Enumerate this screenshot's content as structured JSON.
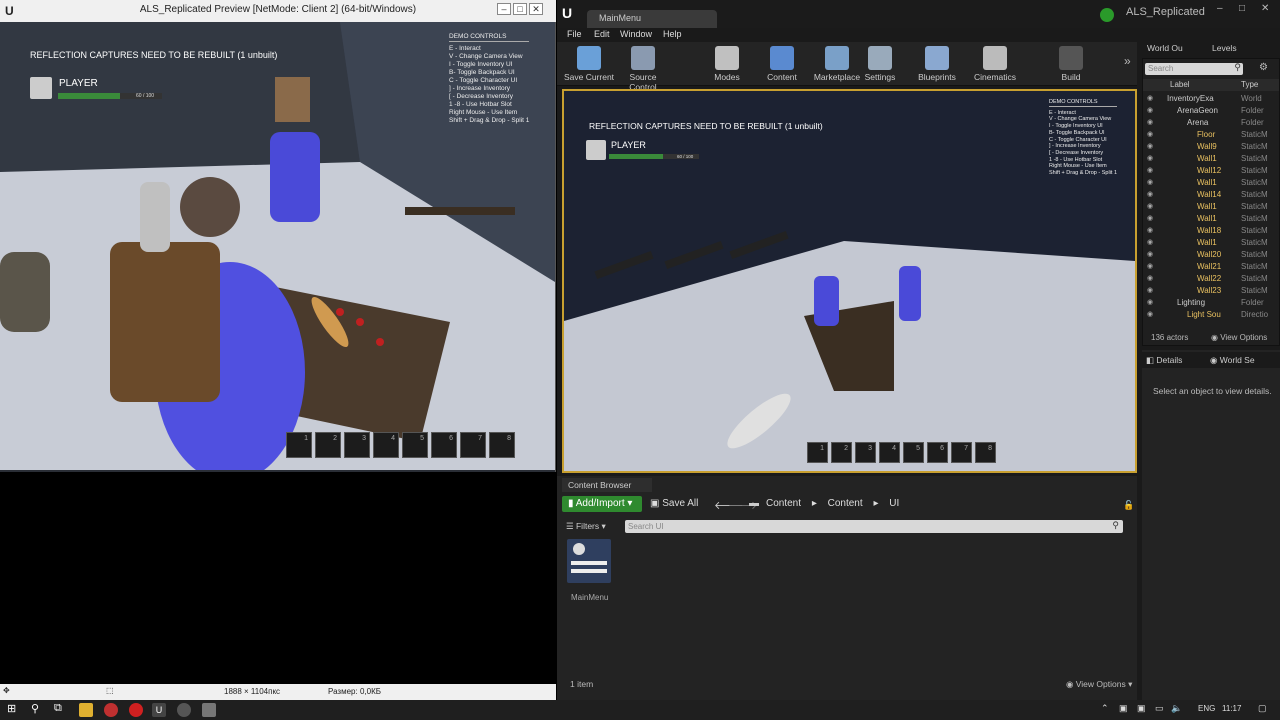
{
  "preview": {
    "title": "ALS_Replicated Preview [NetMode: Client 2]  (64-bit/Windows)",
    "warning": "REFLECTION CAPTURES NEED TO BE REBUILT (1 unbuilt)",
    "player_name": "PLAYER",
    "health_text": "60 / 100",
    "health_fraction": 0.6,
    "demo_title": "DEMO CONTROLS",
    "demo_lines": [
      "E - Interact",
      "V - Change Camera View",
      "I - Toggle Inventory UI",
      "B- Toggle Backpack UI",
      "C - Toggle Character UI",
      "] - Increase Inventory",
      "[ - Decrease Inventory",
      "1 -8 - Use Hotbar Slot",
      "Right Mouse - Use Item",
      "Shift + Drag & Drop - Split 1"
    ],
    "hotbar": [
      "1",
      "2",
      "3",
      "4",
      "5",
      "6",
      "7",
      "8"
    ]
  },
  "statusbar": {
    "dimensions": "1888 × 1104пкс",
    "size": "Размер: 0,0КБ"
  },
  "editor": {
    "tab": "MainMenu",
    "project": "ALS_Replicated",
    "menu": [
      "File",
      "Edit",
      "Window",
      "Help"
    ],
    "toolbar": [
      {
        "label": "Save Current",
        "icon": "save-icon",
        "color": "#6aa0d8"
      },
      {
        "label": "Source Control",
        "icon": "source-control-icon",
        "color": "#8a9ab0"
      },
      {
        "label": "Modes",
        "icon": "modes-icon",
        "color": "#c0c0c0"
      },
      {
        "label": "Content",
        "icon": "content-icon",
        "color": "#5a8ad0"
      },
      {
        "label": "Marketplace",
        "icon": "marketplace-icon",
        "color": "#7aa0c8"
      },
      {
        "label": "Settings",
        "icon": "settings-icon",
        "color": "#9ab"
      },
      {
        "label": "Blueprints",
        "icon": "blueprints-icon",
        "color": "#8aa8d0"
      },
      {
        "label": "Cinematics",
        "icon": "cinematics-icon",
        "color": "#bbb"
      },
      {
        "label": "Build",
        "icon": "build-icon",
        "color": "#555"
      }
    ],
    "viewport": {
      "warning": "REFLECTION CAPTURES NEED TO BE REBUILT (1 unbuilt)",
      "player_name": "PLAYER",
      "health_text": "60 / 100",
      "hotbar": [
        "1",
        "2",
        "3",
        "4",
        "5",
        "6",
        "7",
        "8"
      ]
    },
    "outliner": {
      "tabs": [
        "World Ou",
        "Levels"
      ],
      "search_placeholder": "Search",
      "col_label": "Label",
      "col_type": "Type",
      "rows": [
        {
          "label": "InventoryExa",
          "type": "World",
          "indent": 0
        },
        {
          "label": "ArenaGeon",
          "type": "Folder",
          "indent": 1
        },
        {
          "label": "Arena",
          "type": "Folder",
          "indent": 2
        },
        {
          "label": "Floor",
          "type": "StaticM",
          "indent": 3
        },
        {
          "label": "Wall9",
          "type": "StaticM",
          "indent": 3
        },
        {
          "label": "Wall1",
          "type": "StaticM",
          "indent": 3
        },
        {
          "label": "Wall12",
          "type": "StaticM",
          "indent": 3
        },
        {
          "label": "Wall1",
          "type": "StaticM",
          "indent": 3
        },
        {
          "label": "Wall14",
          "type": "StaticM",
          "indent": 3
        },
        {
          "label": "Wall1",
          "type": "StaticM",
          "indent": 3
        },
        {
          "label": "Wall1",
          "type": "StaticM",
          "indent": 3
        },
        {
          "label": "Wall18",
          "type": "StaticM",
          "indent": 3
        },
        {
          "label": "Wall1",
          "type": "StaticM",
          "indent": 3
        },
        {
          "label": "Wall20",
          "type": "StaticM",
          "indent": 3
        },
        {
          "label": "Wall21",
          "type": "StaticM",
          "indent": 3
        },
        {
          "label": "Wall22",
          "type": "StaticM",
          "indent": 3
        },
        {
          "label": "Wall23",
          "type": "StaticM",
          "indent": 3
        },
        {
          "label": "Lighting",
          "type": "Folder",
          "indent": 1
        },
        {
          "label": "Light Sou",
          "type": "Directio",
          "indent": 2
        }
      ],
      "count": "136 actors",
      "view_options": "View Options"
    },
    "details": {
      "tabs": [
        "Details",
        "World Se"
      ],
      "empty_text": "Select an object to view details."
    },
    "content_browser": {
      "tab": "Content Browser",
      "add_import": "Add/Import",
      "save_all": "Save All",
      "path": [
        "Content",
        "Content",
        "UI"
      ],
      "filters": "Filters",
      "search_placeholder": "Search UI",
      "asset_name": "MainMenu",
      "item_count": "1 item",
      "view_options": "View Options"
    }
  },
  "taskbar": {
    "lang": "ENG",
    "time": "11:17"
  }
}
